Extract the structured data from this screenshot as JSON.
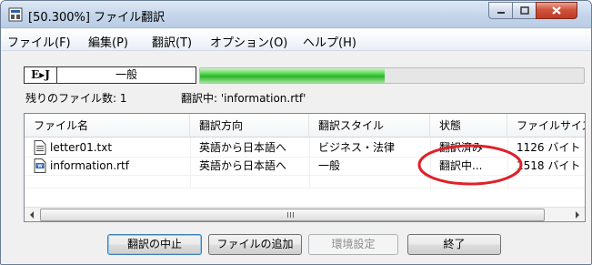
{
  "window": {
    "title": "[50.300%] ファイル翻訳"
  },
  "menu": [
    "ファイル(F)",
    "編集(P)",
    "翻訳(T)",
    "オプション(O)",
    "ヘルプ(H)"
  ],
  "mode": {
    "tag": "E▸J",
    "label": "一般"
  },
  "progress": {
    "value": 0.48,
    "color": "#3fce3a"
  },
  "status": {
    "remaining": "残りのファイル数:  1",
    "translating": "翻訳中: 'information.rtf'"
  },
  "table": {
    "columns": [
      "ファイル名",
      "翻訳方向",
      "翻訳スタイル",
      "状態",
      "ファイルサイズ"
    ],
    "rows": [
      {
        "icon": "text-file-icon",
        "name": "letter01.txt",
        "direction": "英語から日本語へ",
        "style": "ビジネス・法律",
        "state": "翻訳済み",
        "size": "1126 バイト"
      },
      {
        "icon": "rtf-document-icon",
        "name": "information.rtf",
        "direction": "英語から日本語へ",
        "style": "一般",
        "state": "翻訳中...",
        "size": "1518 バイト"
      }
    ]
  },
  "annotation": {
    "color": "#e0202a"
  },
  "buttons": {
    "stop": "翻訳の中止",
    "add": "ファイルの追加",
    "settings": "環境設定",
    "exit": "終了"
  }
}
